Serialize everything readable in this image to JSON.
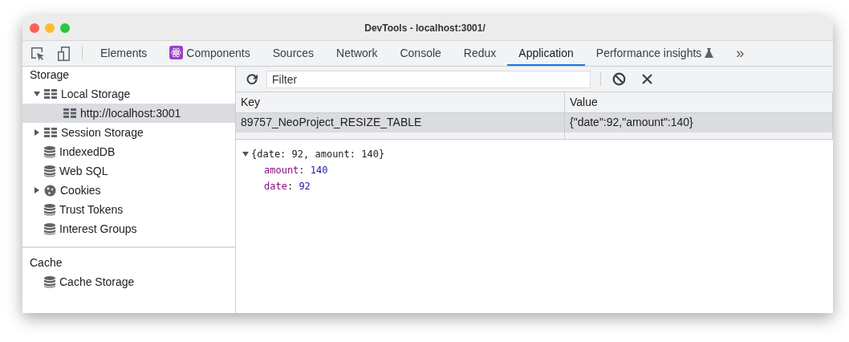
{
  "window": {
    "title": "DevTools - localhost:3001/"
  },
  "toolbar_tools": [
    {
      "kind": "inspect"
    },
    {
      "kind": "device"
    }
  ],
  "tabs": [
    {
      "label": "Elements",
      "selected": false
    },
    {
      "label": "Components",
      "selected": false,
      "kind": "react"
    },
    {
      "label": "Sources",
      "selected": false
    },
    {
      "label": "Network",
      "selected": false
    },
    {
      "label": "Console",
      "selected": false
    },
    {
      "label": "Redux",
      "selected": false
    },
    {
      "label": "Application",
      "selected": true
    },
    {
      "label": "Performance insights",
      "selected": false,
      "kind": "experiment"
    }
  ],
  "more_tabs": "»",
  "sidebar": {
    "sections": [
      {
        "title": "Storage",
        "items": [
          {
            "label": "Local Storage",
            "kind": "table",
            "expanded": true,
            "selected": false,
            "children": [
              {
                "label": "http://localhost:3001",
                "kind": "table",
                "selected": true
              }
            ]
          },
          {
            "label": "Session Storage",
            "kind": "table",
            "expanded": false,
            "selected": false
          },
          {
            "label": "IndexedDB",
            "kind": "database",
            "selected": false
          },
          {
            "label": "Web SQL",
            "kind": "database",
            "selected": false
          },
          {
            "label": "Cookies",
            "kind": "cookie",
            "expanded": false,
            "selected": false
          },
          {
            "label": "Trust Tokens",
            "kind": "database",
            "selected": false
          },
          {
            "label": "Interest Groups",
            "kind": "database",
            "selected": false
          }
        ]
      },
      {
        "title": "Cache",
        "items": [
          {
            "label": "Cache Storage",
            "kind": "database",
            "selected": false
          }
        ]
      }
    ]
  },
  "filter": {
    "placeholder": "Filter"
  },
  "table": {
    "columns": [
      "Key",
      "Value"
    ],
    "rows": [
      {
        "cells": [
          "89757_NeoProject_RESIZE_TABLE",
          "{\"date\":92,\"amount\":140}"
        ],
        "selected": true
      }
    ]
  },
  "preview": {
    "summary": "{date: 92, amount: 140}",
    "expanded": true,
    "separator": ":",
    "properties": [
      {
        "key": "amount",
        "value": "140"
      },
      {
        "key": "date",
        "value": "92"
      }
    ]
  }
}
